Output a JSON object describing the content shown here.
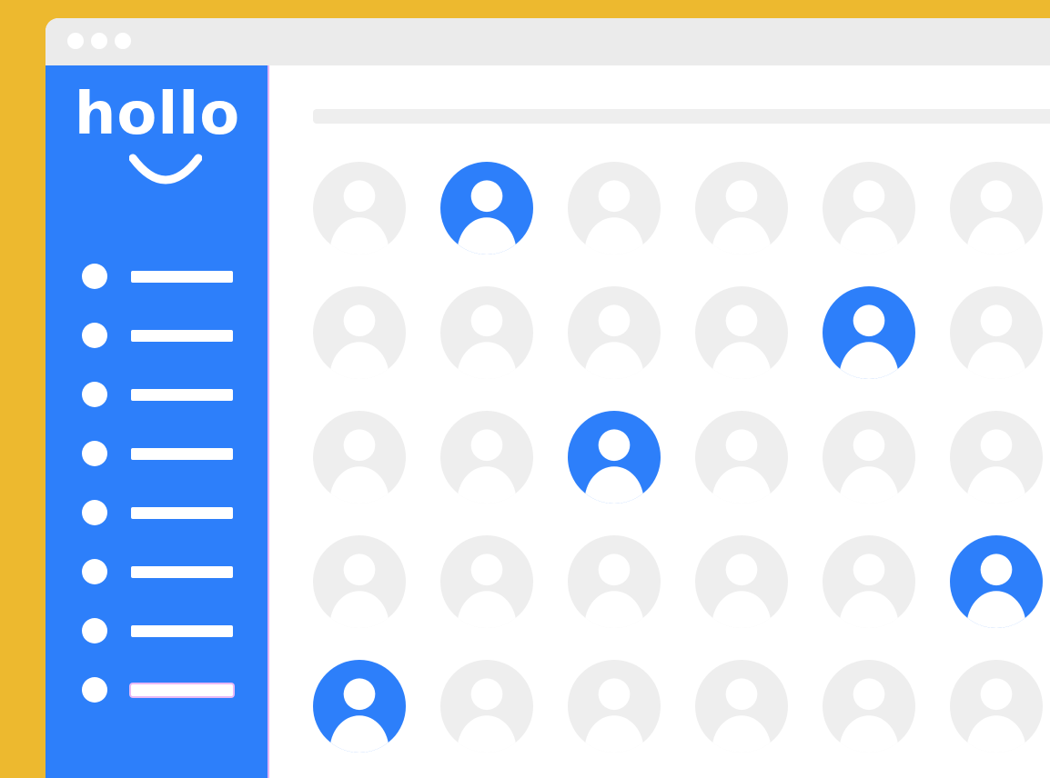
{
  "app": {
    "logo_text": "hollo"
  },
  "colors": {
    "background": "#EDB92F",
    "window": "#FFFFFF",
    "titlebar": "#EBEBEB",
    "titlebar_dot": "#FFFFFF",
    "sidebar": "#2D7FFA",
    "sidebar_edge": "#E2B3F5",
    "sidebar_fg": "#FFFFFF",
    "sidebar_active_bar_border": "#E8B8F6",
    "header_bar": "#EEEEEE",
    "avatar_inactive": "#EEEEEE",
    "avatar_active": "#2D7FFA",
    "avatar_figure_on_active": "#FFFFFF"
  },
  "titlebar": {
    "dots": [
      "dot-1",
      "dot-2",
      "dot-3"
    ]
  },
  "sidebar": {
    "items": [
      {
        "name": "menu-item-1",
        "active": false
      },
      {
        "name": "menu-item-2",
        "active": false
      },
      {
        "name": "menu-item-3",
        "active": false
      },
      {
        "name": "menu-item-4",
        "active": false
      },
      {
        "name": "menu-item-5",
        "active": false
      },
      {
        "name": "menu-item-6",
        "active": false
      },
      {
        "name": "menu-item-7",
        "active": false
      },
      {
        "name": "menu-item-8",
        "active": true
      }
    ]
  },
  "avatar_grid": {
    "rows": 5,
    "columns": 6,
    "highlighted": [
      [
        false,
        true,
        false,
        false,
        false,
        false
      ],
      [
        false,
        false,
        false,
        false,
        true,
        false
      ],
      [
        false,
        false,
        true,
        false,
        false,
        false
      ],
      [
        false,
        false,
        false,
        false,
        false,
        true
      ],
      [
        true,
        false,
        false,
        false,
        false,
        false
      ]
    ]
  },
  "icons": {
    "avatar": "user-avatar-icon",
    "logo_smile": "smile-icon"
  }
}
